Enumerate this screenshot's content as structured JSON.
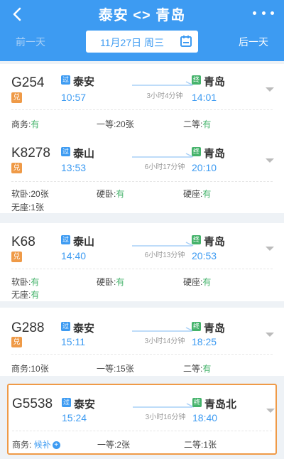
{
  "header": {
    "title": "泰安 <> 青岛",
    "prev_day": "前一天",
    "next_day": "后一天",
    "date": "11月27日 周三"
  },
  "colors": {
    "primary": "#3d9bf2",
    "green": "#45b36b",
    "orange": "#ef9a47"
  },
  "trains": [
    {
      "no": "G254",
      "dui": "兑",
      "from_badge": "过",
      "from": "泰安",
      "dep": "10:57",
      "duration": "3小时4分钟",
      "to_badge": "终",
      "to": "青岛",
      "arr": "14:01",
      "seats": [
        {
          "label": "商务:",
          "value": "有"
        },
        {
          "label": "一等:",
          "value": "20张"
        },
        {
          "label": "二等:",
          "value": "有"
        }
      ]
    },
    {
      "no": "K8278",
      "dui": "兑",
      "from_badge": "过",
      "from": "泰山",
      "dep": "13:53",
      "duration": "6小时17分钟",
      "to_badge": "终",
      "to": "青岛",
      "arr": "20:10",
      "seats": [
        {
          "label": "软卧:",
          "value": "20张"
        },
        {
          "label": "硬卧:",
          "value": "有"
        },
        {
          "label": "硬座:",
          "value": "有"
        },
        {
          "label": "无座:",
          "value": "1张"
        }
      ]
    },
    {
      "no": "K68",
      "dui": "兑",
      "from_badge": "过",
      "from": "泰山",
      "dep": "14:40",
      "duration": "6小时13分钟",
      "to_badge": "终",
      "to": "青岛",
      "arr": "20:53",
      "seats": [
        {
          "label": "软卧:",
          "value": "有"
        },
        {
          "label": "硬卧:",
          "value": "有"
        },
        {
          "label": "硬座:",
          "value": "有"
        },
        {
          "label": "无座:",
          "value": "有"
        }
      ]
    },
    {
      "no": "G288",
      "dui": "兑",
      "from_badge": "过",
      "from": "泰安",
      "dep": "15:11",
      "duration": "3小时14分钟",
      "to_badge": "终",
      "to": "青岛",
      "arr": "18:25",
      "seats": [
        {
          "label": "商务:",
          "value": "10张"
        },
        {
          "label": "一等:",
          "value": "15张"
        },
        {
          "label": "二等:",
          "value": "有"
        }
      ]
    },
    {
      "no": "G5538",
      "from_badge": "过",
      "from": "泰安",
      "dep": "15:24",
      "duration": "3小时16分钟",
      "to_badge": "终",
      "to": "青岛北",
      "arr": "18:40",
      "seats": [
        {
          "label": "商务:",
          "value": "候补"
        },
        {
          "label": "一等:",
          "value": "2张"
        },
        {
          "label": "二等:",
          "value": "1张"
        }
      ]
    }
  ]
}
